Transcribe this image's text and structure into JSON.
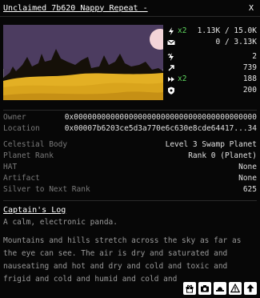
{
  "window": {
    "title": "Unclaimed 7b620 Nappy Repeat -",
    "close_label": "X"
  },
  "stats": [
    {
      "icon": "lightning-icon",
      "mult": "x2",
      "value": "1.13K / 15.0K"
    },
    {
      "icon": "envelope-icon",
      "mult": "",
      "value": "0 / 3.13K"
    },
    {
      "icon": "lightning-icon",
      "mult": "",
      "value": "2"
    },
    {
      "icon": "arrow-up-right-icon",
      "mult": "",
      "value": "739"
    },
    {
      "icon": "fast-forward-icon",
      "mult": "x2",
      "value": "188"
    },
    {
      "icon": "shield-icon",
      "mult": "",
      "value": "200"
    }
  ],
  "info": {
    "owner_label": "Owner",
    "owner_value": "0x0000000000000000000000000000000000000000",
    "location_label": "Location",
    "location_value": "0x00007b6203ce5d3a770e6c630e8cde64417...34",
    "celestial_label": "Celestial Body",
    "celestial_value": "Level 3 Swamp Planet",
    "rank_label": "Planet Rank",
    "rank_value": "Rank 0 (Planet)",
    "hat_label": "HAT",
    "hat_value": "None",
    "artifact_label": "Artifact",
    "artifact_value": "None",
    "silver_label": "Silver to Next Rank",
    "silver_value": "625"
  },
  "log": {
    "title": "Captain's Log",
    "tagline": "A calm, electronic panda.",
    "body": "Mountains and hills stretch across the sky as far as the eye can see. The air is dry and saturated and nauseating and hot and dry and cold and toxic and frigid and cold and humid and cold and"
  },
  "footer_buttons": [
    "gift-icon",
    "camera-icon",
    "hat-icon",
    "warning-icon",
    "upload-icon"
  ],
  "colors": {
    "sky": "#4a3a5c",
    "sand": "#e8b830",
    "moon": "#f3d4d8",
    "multiplier": "#5fd75f"
  }
}
